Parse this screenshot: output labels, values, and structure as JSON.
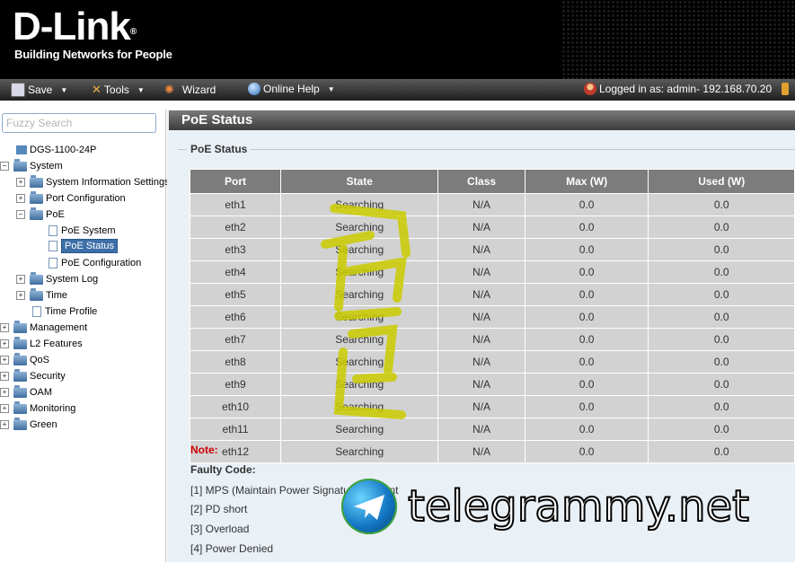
{
  "brand": {
    "logo": "D-Link",
    "reg": "®",
    "tagline": "Building Networks for People"
  },
  "toolbar": {
    "save": "Save",
    "tools": "Tools",
    "wizard": "Wizard",
    "help": "Online Help",
    "login": "Logged in as: admin- 192.168.70.20"
  },
  "sidebar": {
    "search_placeholder": "Fuzzy Search",
    "device": "DGS-1100-24P",
    "system": "System",
    "system_info": "System Information Settings",
    "port_config": "Port Configuration",
    "poe": "PoE",
    "poe_system": "PoE System",
    "poe_status": "PoE Status",
    "poe_config": "PoE Configuration",
    "system_log": "System Log",
    "time": "Time",
    "time_profile": "Time Profile",
    "management": "Management",
    "l2": "L2 Features",
    "qos": "QoS",
    "security": "Security",
    "oam": "OAM",
    "monitoring": "Monitoring",
    "green": "Green"
  },
  "content": {
    "title": "PoE Status",
    "section": "PoE Status",
    "columns": [
      "Port",
      "State",
      "Class",
      "Max (W)",
      "Used (W)"
    ],
    "rows": [
      [
        "eth1",
        "Searching",
        "N/A",
        "0.0",
        "0.0"
      ],
      [
        "eth2",
        "Searching",
        "N/A",
        "0.0",
        "0.0"
      ],
      [
        "eth3",
        "Searching",
        "N/A",
        "0.0",
        "0.0"
      ],
      [
        "eth4",
        "Searching",
        "N/A",
        "0.0",
        "0.0"
      ],
      [
        "eth5",
        "Searching",
        "N/A",
        "0.0",
        "0.0"
      ],
      [
        "eth6",
        "Searching",
        "N/A",
        "0.0",
        "0.0"
      ],
      [
        "eth7",
        "Searching",
        "N/A",
        "0.0",
        "0.0"
      ],
      [
        "eth8",
        "Searching",
        "N/A",
        "0.0",
        "0.0"
      ],
      [
        "eth9",
        "Searching",
        "N/A",
        "0.0",
        "0.0"
      ],
      [
        "eth10",
        "Searching",
        "N/A",
        "0.0",
        "0.0"
      ],
      [
        "eth11",
        "Searching",
        "N/A",
        "0.0",
        "0.0"
      ],
      [
        "eth12",
        "Searching",
        "N/A",
        "0.0",
        "0.0"
      ]
    ],
    "note": "Note:",
    "faulty": "Faulty Code:",
    "codes": [
      "[1] MPS (Maintain Power Signature) Absent",
      "[2] PD short",
      "[3] Overload",
      "[4] Power Denied"
    ]
  },
  "watermark": {
    "text": "telegrammy.net"
  },
  "colors": {
    "header": "#000000",
    "toolbar": "#2e2e2e",
    "selected": "#3d6fa8",
    "note": "#cc0000",
    "table_head": "#7c7c7c",
    "table_cell": "#d2d2d2"
  }
}
